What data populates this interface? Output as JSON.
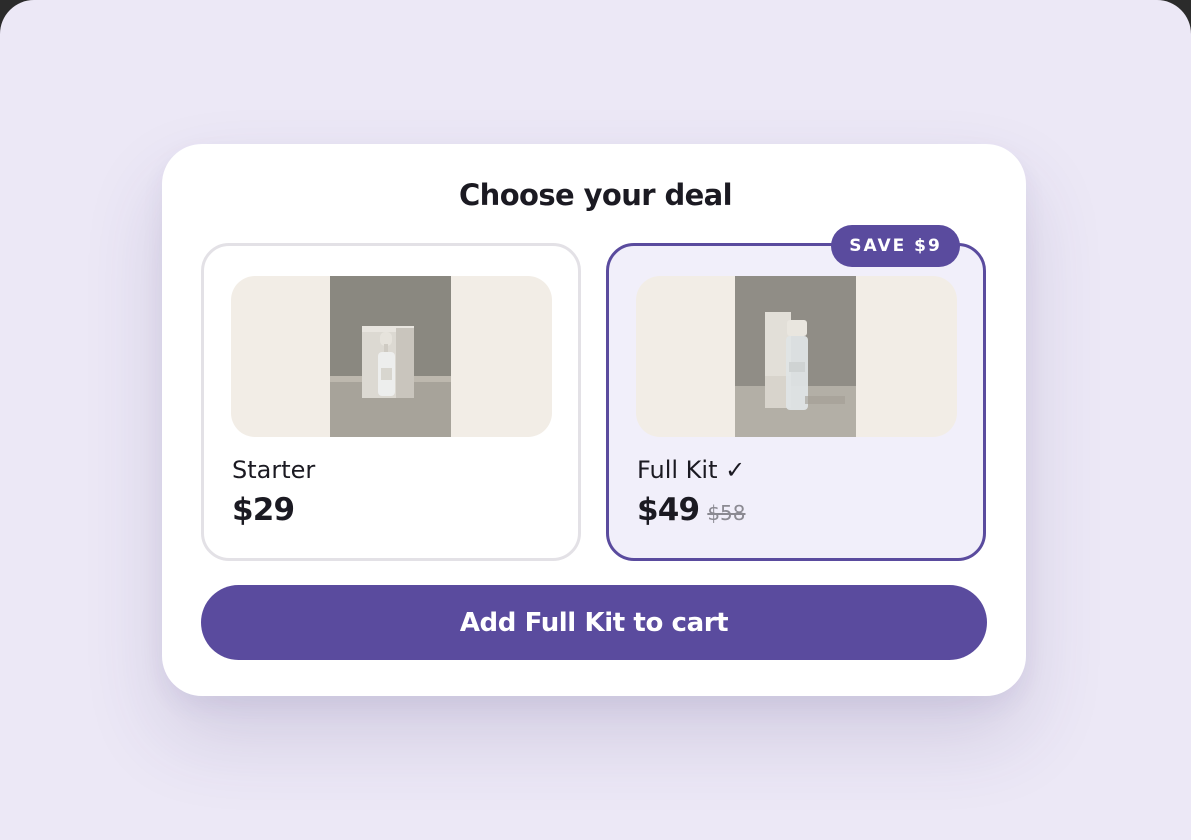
{
  "title": "Choose your deal",
  "badge": "SAVE $9",
  "options": [
    {
      "name": "Starter",
      "price": "$29",
      "old_price": "",
      "selected": false
    },
    {
      "name": "Full Kit ✓",
      "price": "$49",
      "old_price": "$58",
      "selected": true
    }
  ],
  "cta": "Add Full Kit to cart",
  "colors": {
    "accent": "#5a4b9e",
    "page_background": "#ece8f6",
    "selected_background": "#f1effa",
    "thumbnail_background": "#f2ede6"
  }
}
